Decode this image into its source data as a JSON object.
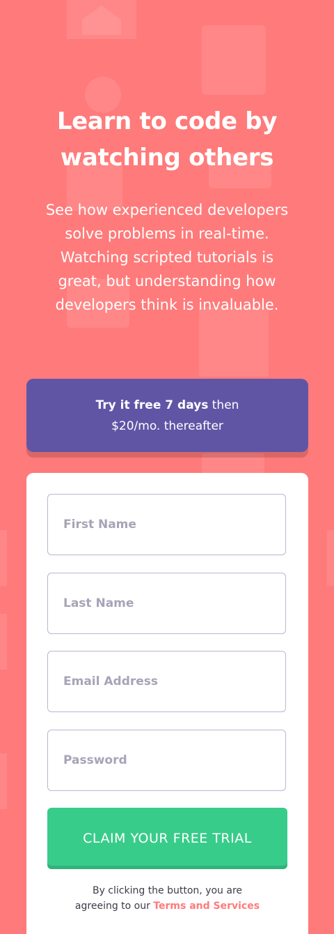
{
  "colors": {
    "background": "#ff7a7a",
    "promo": "#6055a5",
    "cta": "#38cc8b",
    "accent": "#ff7a7a"
  },
  "hero": {
    "title_line1": "Learn to code by",
    "title_line2": "watching others",
    "description_lines": [
      "See how experienced developers",
      "solve problems in real-time.",
      "Watching scripted tutorials is",
      "great, but understanding how",
      "developers think is invaluable."
    ]
  },
  "promo": {
    "bold": "Try it free 7 days",
    "rest": "then",
    "line2": "$20/mo. thereafter"
  },
  "form": {
    "first_name_placeholder": "First Name",
    "last_name_placeholder": "Last Name",
    "email_placeholder": "Email Address",
    "password_placeholder": "Password",
    "submit_label": "CLAIM YOUR FREE TRIAL",
    "terms_line1": "By clicking the button, you are",
    "terms_prefix": "agreeing to our",
    "terms_link": "Terms and Services"
  }
}
